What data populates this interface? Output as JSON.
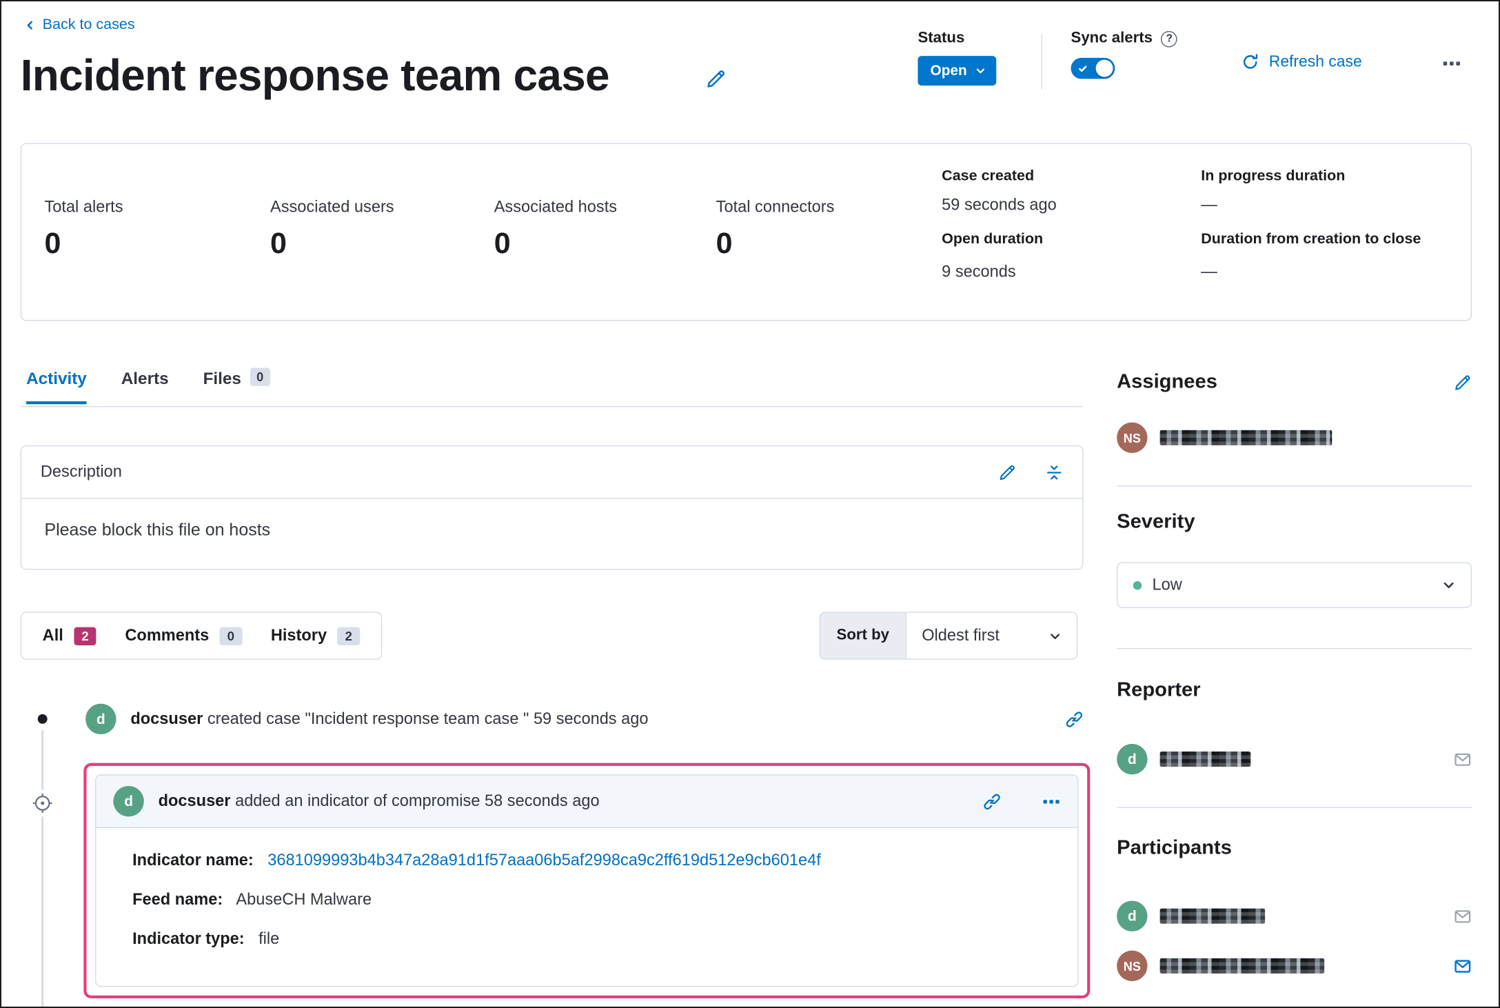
{
  "header": {
    "back_link": "Back to cases",
    "title": "Incident response team case",
    "status_label": "Status",
    "status_value": "Open",
    "sync_alerts_label": "Sync alerts",
    "refresh_label": "Refresh case"
  },
  "stats": {
    "metrics": [
      {
        "label": "Total alerts",
        "value": "0"
      },
      {
        "label": "Associated users",
        "value": "0"
      },
      {
        "label": "Associated hosts",
        "value": "0"
      },
      {
        "label": "Total connectors",
        "value": "0"
      }
    ],
    "case_created_label": "Case created",
    "case_created_value": "59 seconds ago",
    "open_duration_label": "Open duration",
    "open_duration_value": "9 seconds",
    "in_progress_label": "In progress duration",
    "in_progress_value": "—",
    "creation_to_close_label": "Duration from creation to close",
    "creation_to_close_value": "—"
  },
  "tabs": {
    "activity": "Activity",
    "alerts": "Alerts",
    "files": "Files",
    "files_count": "0"
  },
  "description": {
    "title": "Description",
    "body": "Please block this file on hosts"
  },
  "filters": {
    "all_label": "All",
    "all_count": "2",
    "comments_label": "Comments",
    "comments_count": "0",
    "history_label": "History",
    "history_count": "2",
    "sort_by_label": "Sort by",
    "sort_value": "Oldest first"
  },
  "timeline": {
    "created": {
      "avatar": "d",
      "user": "docsuser",
      "text": "created case \"Incident response team case \" 59 seconds ago"
    },
    "indicator": {
      "avatar": "d",
      "user": "docsuser",
      "text": "added an indicator of compromise 58 seconds ago",
      "fields": [
        {
          "label": "Indicator name:",
          "value": "3681099993b4b347a28a91d1f57aaa06b5af2998ca9c2ff619d512e9cb601e4f"
        },
        {
          "label": "Feed name:",
          "value": "AbuseCH Malware"
        },
        {
          "label": "Indicator type:",
          "value": "file"
        }
      ]
    }
  },
  "sidebar": {
    "assignees_title": "Assignees",
    "assignee_avatar": "NS",
    "severity_title": "Severity",
    "severity_value": "Low",
    "reporter_title": "Reporter",
    "reporter_avatar": "d",
    "participants_title": "Participants",
    "participant1_avatar": "d",
    "participant2_avatar": "NS"
  },
  "colors": {
    "primary_blue": "#0071c2",
    "button_blue": "#0077cc",
    "highlight_pink": "#e23e7e",
    "accent_badge": "#b93370",
    "severity_low_green": "#54b399",
    "avatar_green": "#57a284",
    "avatar_brown": "#a4685a",
    "border_gray": "#d3dae6"
  }
}
